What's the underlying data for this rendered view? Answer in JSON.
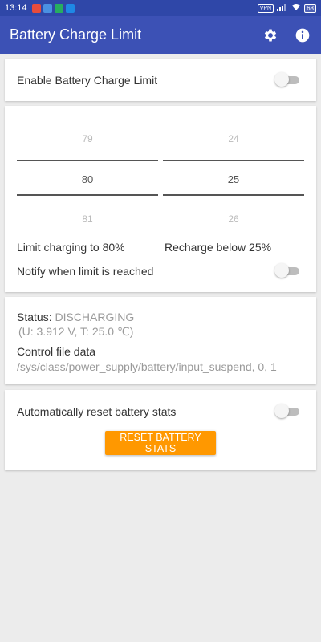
{
  "statusbar": {
    "time": "13:14",
    "vpn": "VPN",
    "battery": "68"
  },
  "appbar": {
    "title": "Battery Charge Limit",
    "settings_icon": "gear-icon",
    "info_icon": "info-icon",
    "color": "#3c51b5"
  },
  "enable_card": {
    "label": "Enable Battery Charge Limit",
    "enabled": false
  },
  "limits_card": {
    "limit_picker": {
      "above": "79",
      "value": "80",
      "below": "81"
    },
    "recharge_picker": {
      "above": "24",
      "value": "25",
      "below": "26"
    },
    "limit_label": "Limit charging to 80%",
    "recharge_label": "Recharge below 25%",
    "notify_label": "Notify when limit is reached",
    "notify_enabled": false
  },
  "status_card": {
    "status_prefix": "Status:",
    "status_value": "DISCHARGING",
    "details": "(U: 3.912 V, T: 25.0 ℃)",
    "control_title": "Control file data",
    "control_value": "/sys/class/power_supply/battery/input_suspend, 0, 1"
  },
  "reset_card": {
    "auto_reset_label": "Automatically reset battery stats",
    "auto_reset_enabled": false,
    "reset_button": "RESET BATTERY STATS",
    "button_color": "#ff9800"
  }
}
